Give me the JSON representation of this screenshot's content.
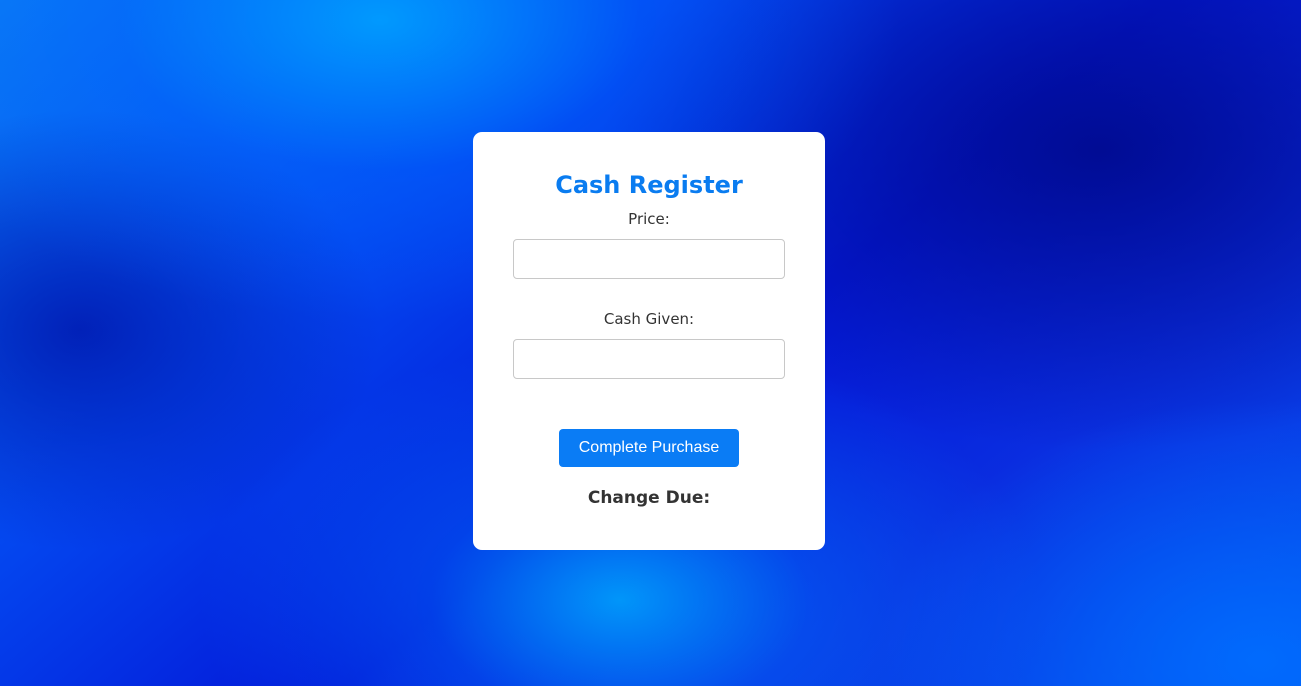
{
  "page": {
    "background_colors": [
      "#0a7cf5",
      "#0418d8",
      "#000a8c",
      "#00aaff"
    ]
  },
  "card": {
    "title": "Cash Register",
    "title_color": "#0a7cf0",
    "price_label": "Price:",
    "price_value": "",
    "cash_label": "Cash Given:",
    "cash_value": "",
    "submit_label": "Complete Purchase",
    "submit_color": "#0a7cf5",
    "change_label": "Change Due:"
  }
}
